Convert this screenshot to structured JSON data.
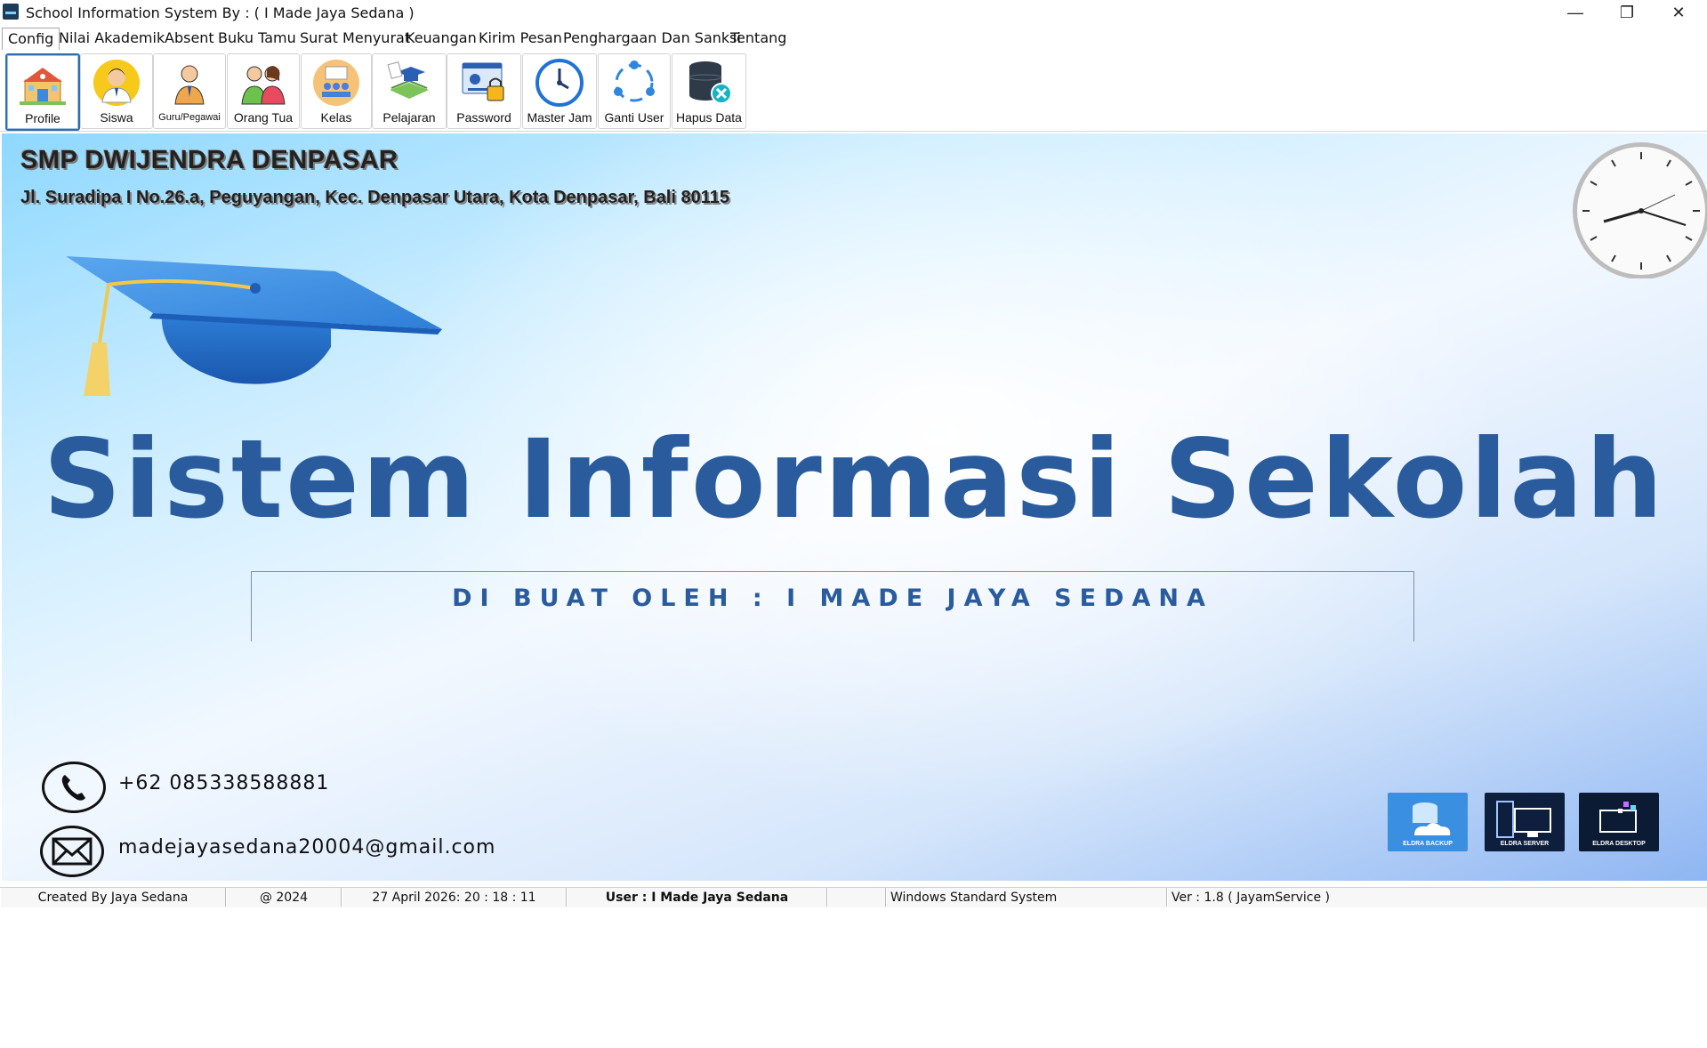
{
  "window": {
    "title": "School Information System By : ( I Made Jaya Sedana )",
    "minimize": "—",
    "restore": "❐",
    "close": "✕"
  },
  "menu": [
    "Config",
    "Nilai Akademik",
    "Absent",
    "Buku Tamu",
    "Surat Menyurat",
    "Keuangan",
    "Kirim Pesan",
    "Penghargaan Dan Sanksi",
    "Tentang"
  ],
  "toolbar": [
    {
      "label": "Profile",
      "icon": "school-building-icon"
    },
    {
      "label": "Siswa",
      "icon": "student-icon"
    },
    {
      "label": "Guru/Pegawai",
      "icon": "teacher-icon"
    },
    {
      "label": "Orang Tua",
      "icon": "parents-icon"
    },
    {
      "label": "Kelas",
      "icon": "classroom-icon"
    },
    {
      "label": "Pelajaran",
      "icon": "graduation-book-icon"
    },
    {
      "label": "Password",
      "icon": "password-lock-icon"
    },
    {
      "label": "Master Jam",
      "icon": "clock-icon"
    },
    {
      "label": "Ganti User",
      "icon": "switch-user-icon"
    },
    {
      "label": "Hapus Data",
      "icon": "delete-database-icon"
    }
  ],
  "school": {
    "name": "SMP DWIJENDRA DENPASAR",
    "address": "Jl. Suradipa I No.26.a, Peguyangan, Kec. Denpasar Utara, Kota Denpasar, Bali 80115"
  },
  "headline": "Sistem Informasi Sekolah",
  "credit": "DI BUAT OLEH : I MADE JAYA SEDANA",
  "contact": {
    "phone": "+62 085338588881",
    "email": "madejayasedana20004@gmail.com"
  },
  "logos": [
    {
      "label": "ELDRA BACKUP",
      "color": "#3a8fe0"
    },
    {
      "label": "ELDRA SERVER",
      "color": "#0d1f3c"
    },
    {
      "label": "ELDRA DESKTOP",
      "color": "#0b1b33"
    }
  ],
  "status": {
    "created_by": "Created By Jaya Sedana",
    "year": "@ 2024",
    "datetime": "27 April 2026: 20 : 18 : 11",
    "user": "User : I Made Jaya Sedana",
    "blank": "",
    "system": "Windows Standard System",
    "version": "Ver : 1.8 ( JayamService )"
  }
}
